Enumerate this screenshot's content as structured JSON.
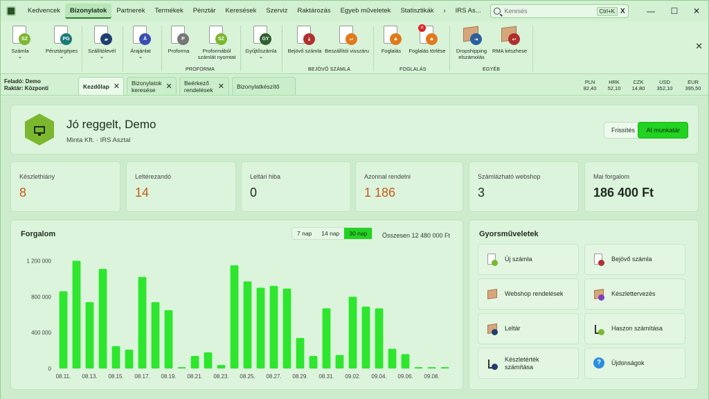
{
  "menu": {
    "items": [
      "Kedvencek",
      "Bizonylatok",
      "Partnerek",
      "Termékek",
      "Pénztár",
      "Keresések",
      "Szerviz",
      "Raktározás",
      "Egyeb műveletek",
      "Statisztikák",
      "›",
      "IRS As..."
    ],
    "active_index": 1,
    "search_placeholder": "Keresés",
    "search_shortcut": "Ctrl+K",
    "search_clear": "X"
  },
  "window_controls": {
    "minimize": "—",
    "maximize": "☐",
    "close": "✕"
  },
  "ribbon": {
    "buttons": [
      {
        "label": "Számla",
        "badge": "SZ",
        "color": "#7cb82f",
        "chevron": "⌄"
      },
      {
        "label": "Pénztárgépes",
        "badge": "PG",
        "color": "#1a7a7a",
        "chevron": "⌄"
      },
      {
        "label": "Szállítólevél",
        "badge": "",
        "color": "#1f3f6f",
        "chevron": "⌄"
      },
      {
        "label": "Árajánlat",
        "badge": "Á",
        "color": "#3a4fb0",
        "chevron": "⌄"
      },
      {
        "label": "Proforma",
        "badge": "P",
        "color": "#777777",
        "chevron": ""
      },
      {
        "label": "Proformából számlát nyomtat",
        "badge": "SZ",
        "color": "#7cb82f",
        "chevron": ""
      },
      {
        "label": "Gyűjtőszámla",
        "badge": "GY",
        "color": "#2f5f2f",
        "chevron": "⌄"
      },
      {
        "label": "Bejövő számla",
        "badge": "",
        "color": "#b03030",
        "chevron": ""
      },
      {
        "label": "Beszállítói visszáru",
        "badge": "",
        "color": "#e07a1a",
        "chevron": ""
      },
      {
        "label": "Foglalás",
        "badge": "",
        "color": "#e07a1a",
        "chevron": ""
      },
      {
        "label": "Foglalás törlése",
        "badge": "",
        "color": "#e07a1a",
        "chevron": ""
      },
      {
        "label": "Dropshipping elszámolás",
        "badge": "",
        "color": "#2b5fa0",
        "chevron": ""
      },
      {
        "label": "RMA készhese",
        "badge": "",
        "color": "#b03030",
        "chevron": ""
      }
    ],
    "groups": [
      "PROFORMA",
      "BEJÖVŐ SZÁMLA",
      "FOGLALÁS",
      "EGYÉB"
    ],
    "close": "✕"
  },
  "tabbar": {
    "sender": "Feladó: Demo",
    "warehouse": "Raktár: Központi",
    "tabs": [
      {
        "label": "Kezdőlap",
        "close": "✕"
      },
      {
        "label": "Bizonylatok keresése",
        "close": "✕"
      },
      {
        "label": "Beérkező rendelések",
        "close": "✕"
      },
      {
        "label": "Bizonylatkészítő",
        "close": "✕"
      }
    ],
    "currencies": [
      {
        "code": "PLN",
        "rate": "82,40"
      },
      {
        "code": "HRK",
        "rate": "52,10"
      },
      {
        "code": "CZK",
        "rate": "14,80"
      },
      {
        "code": "USD",
        "rate": "352,10"
      },
      {
        "code": "EUR",
        "rate": "395,50"
      }
    ]
  },
  "header": {
    "greeting": "Jó reggelt, Demo",
    "subtitle": "Minta Kft. · IRS Asztal",
    "refresh": "Frissítés",
    "unit": "AI munkatár"
  },
  "stats": [
    {
      "label": "Készlethiány",
      "value": "8",
      "style": "orange"
    },
    {
      "label": "Leltérezandó",
      "value": "14",
      "style": "orange"
    },
    {
      "label": "Leltári hiba",
      "value": "0",
      "style": "dark"
    },
    {
      "label": "Azonnal rendelni",
      "value": "1 186",
      "style": "orange"
    },
    {
      "label": "Számlázható webshop",
      "value": "3",
      "style": "dark"
    },
    {
      "label": "Mai forgalom",
      "value": "186 400 Ft",
      "style": "bold"
    }
  ],
  "turnover": {
    "title": "Forgalom",
    "ranges": [
      "7 nap",
      "14 nap",
      "30 nap"
    ],
    "active_range": 2,
    "total": "Összesen 12 480 000 Ft"
  },
  "chart_data": {
    "type": "bar",
    "title": "Forgalom",
    "categories": [
      "08.11.",
      "08.12.",
      "08.13.",
      "08.14.",
      "08.15.",
      "08.16.",
      "08.17.",
      "08.18.",
      "08.19.",
      "08.20.",
      "08.21.",
      "08.22.",
      "08.23.",
      "08.24.",
      "08.25.",
      "08.26.",
      "08.27.",
      "08.28.",
      "08.29.",
      "08.30.",
      "08.31.",
      "09.01.",
      "09.02.",
      "09.03.",
      "09.04.",
      "09.05.",
      "09.06.",
      "09.07.",
      "09.08.",
      "09.09."
    ],
    "tick_labels": [
      "08.11.",
      "08.13.",
      "08.15.",
      "08.17.",
      "08.19.",
      "08.21.",
      "08.23.",
      "08.25.",
      "08.27.",
      "08.29.",
      "08.31.",
      "09.02.",
      "09.04.",
      "09.06.",
      "09.08."
    ],
    "values": [
      860000,
      1200000,
      740000,
      1110000,
      250000,
      210000,
      1020000,
      740000,
      650000,
      0,
      140000,
      180000,
      40000,
      1150000,
      970000,
      900000,
      920000,
      890000,
      340000,
      140000,
      670000,
      150000,
      800000,
      690000,
      670000,
      220000,
      160000,
      10000,
      10000,
      10000
    ],
    "yticks": [
      0,
      400000,
      800000,
      1200000
    ],
    "ytick_labels": [
      "0",
      "400 000",
      "800 000",
      "1 200 000"
    ],
    "ylim": [
      0,
      1250000
    ],
    "color": "#2ee62e",
    "grid": false
  },
  "quick_actions": {
    "title": "Gyorsműveletek",
    "items": [
      {
        "label": "Új számla",
        "icon": "new-invoice-icon"
      },
      {
        "label": "Bejövő számla",
        "icon": "incoming-invoice-icon"
      },
      {
        "label": "Webshop rendelések",
        "icon": "webshop-box-icon"
      },
      {
        "label": "Készlettervezés",
        "icon": "stock-planning-icon"
      },
      {
        "label": "Leltár",
        "icon": "inventory-icon"
      },
      {
        "label": "Haszon számítása",
        "icon": "profit-chart-icon"
      },
      {
        "label": "Készletérték számítása",
        "icon": "stock-value-icon"
      },
      {
        "label": "Újdonságok",
        "icon": "help-icon",
        "glyph": "?"
      }
    ]
  }
}
